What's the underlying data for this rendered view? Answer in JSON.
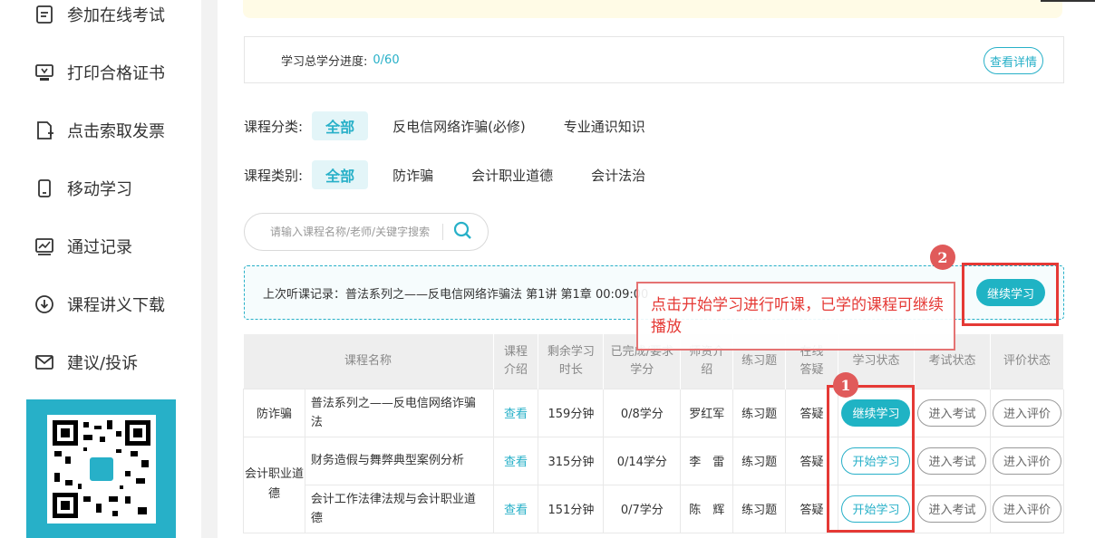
{
  "sidebar": {
    "items": [
      {
        "label": "参加在线考试",
        "icon": "exam-icon"
      },
      {
        "label": "打印合格证书",
        "icon": "certificate-icon"
      },
      {
        "label": "点击索取发票",
        "icon": "invoice-icon"
      },
      {
        "label": "移动学习",
        "icon": "mobile-icon"
      },
      {
        "label": "通过记录",
        "icon": "chart-icon"
      },
      {
        "label": "课程讲义下载",
        "icon": "download-icon"
      },
      {
        "label": "建议/投诉",
        "icon": "mail-icon"
      }
    ],
    "qr_color": "#27b0c8"
  },
  "progress": {
    "label": "学习总学分进度:",
    "value": "0/60",
    "detail_button": "查看详情"
  },
  "filters": {
    "category": {
      "label": "课程分类:",
      "options": [
        "全部",
        "反电信网络诈骗(必修)",
        "专业通识知识"
      ],
      "selected": "全部"
    },
    "type": {
      "label": "课程类别:",
      "options": [
        "全部",
        "防诈骗",
        "会计职业道德",
        "会计法治"
      ],
      "selected": "全部"
    }
  },
  "search": {
    "placeholder": "请输入课程名称/老师/关键字搜索"
  },
  "last_record": {
    "text": "上次听课记录：普法系列之——反电信网络诈骗法 第1讲 第1章 00:09:00",
    "button": "继续学习"
  },
  "annotations": {
    "callout": "点击开始学习进行听课，已学的课程可继续播放",
    "badge1": "1",
    "badge2": "2"
  },
  "table": {
    "headers": [
      "课程名称",
      "课程介绍",
      "剩余学习时长",
      "已完成/要求学分",
      "师资介绍",
      "练习题",
      "在线答疑",
      "学习状态",
      "考试状态",
      "评价状态"
    ],
    "rows": [
      {
        "category": "防诈骗",
        "name": "普法系列之——反电信网络诈骗法",
        "intro": "查看",
        "remaining": "159分钟",
        "credits": "0/8学分",
        "teacher": "罗红军",
        "exercise": "练习题",
        "qa": "答疑",
        "study": "继续学习",
        "exam": "进入考试",
        "review": "进入评价"
      },
      {
        "category": "会计职业道德",
        "name": "财务造假与舞弊典型案例分析",
        "intro": "查看",
        "remaining": "315分钟",
        "credits": "0/14学分",
        "teacher": "李　雷",
        "exercise": "练习题",
        "qa": "答疑",
        "study": "开始学习",
        "exam": "进入考试",
        "review": "进入评价"
      },
      {
        "category": "",
        "name": "会计工作法律法规与会计职业道德",
        "intro": "查看",
        "remaining": "151分钟",
        "credits": "0/7学分",
        "teacher": "陈　辉",
        "exercise": "练习题",
        "qa": "答疑",
        "study": "开始学习",
        "exam": "进入考试",
        "review": "进入评价"
      }
    ]
  },
  "colors": {
    "accent": "#27b0c8",
    "annotation": "#e53935"
  }
}
